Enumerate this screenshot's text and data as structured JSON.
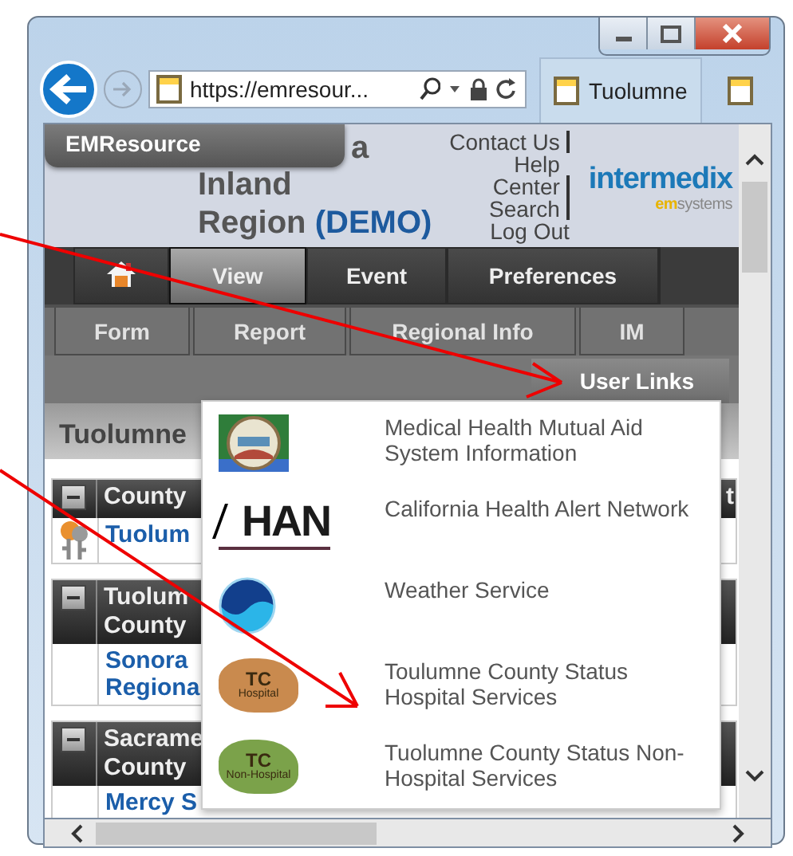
{
  "browser": {
    "address": "https://emresour...",
    "tabs": [
      {
        "label": "Tuolumne",
        "selected": true
      },
      {
        "selected": false
      }
    ]
  },
  "app_badge": "EMResource",
  "header": {
    "title_lines": [
      "a",
      "Inland"
    ],
    "title_last": "Region",
    "title_tag": "(DEMO)",
    "links": [
      {
        "label": "Contact Us",
        "separator": true
      },
      {
        "label": "Help Center",
        "separator": true
      },
      {
        "label": "Search",
        "separator": true
      },
      {
        "label": "Log Out",
        "separator": false
      }
    ],
    "logo": {
      "word": "intermedix",
      "tag_em": "em",
      "tag_rest": "systems"
    }
  },
  "nav": [
    {
      "kind": "home",
      "selected": false
    },
    {
      "kind": "text",
      "label": "View",
      "selected": true
    },
    {
      "kind": "text",
      "label": "Event",
      "selected": false
    },
    {
      "kind": "text",
      "label": "Preferences",
      "selected": false
    }
  ],
  "subnav": [
    "Form",
    "Report",
    "Regional Info",
    "IM"
  ],
  "user_links_button": "User Links",
  "page_heading": "Tuolumne",
  "tables": [
    {
      "header": "County",
      "trailing": "t",
      "rows": [
        {
          "kind": "keys",
          "text": "Tuolum"
        }
      ]
    },
    {
      "header": "Tuolum County",
      "rows": [
        {
          "text": "Sonora Regiona"
        }
      ]
    },
    {
      "header": "Sacrame County",
      "rows": [
        {
          "text": "Mercy S"
        }
      ]
    }
  ],
  "user_links": [
    {
      "kind": "seal",
      "label": "Medical Health Mutual Aid System Information"
    },
    {
      "kind": "han",
      "logo_text": "HAN",
      "label": "California Health Alert Network"
    },
    {
      "kind": "noaa",
      "label": "Weather Service"
    },
    {
      "kind": "tc_hospital",
      "logo_text": "TC",
      "logo_sub": "Hospital",
      "label": "Toulumne County Status Hospital Services"
    },
    {
      "kind": "tc_nonhospital",
      "logo_text": "TC",
      "logo_sub": "Non-Hospital",
      "label": "Tuolumne County Status Non-Hospital Services"
    }
  ]
}
